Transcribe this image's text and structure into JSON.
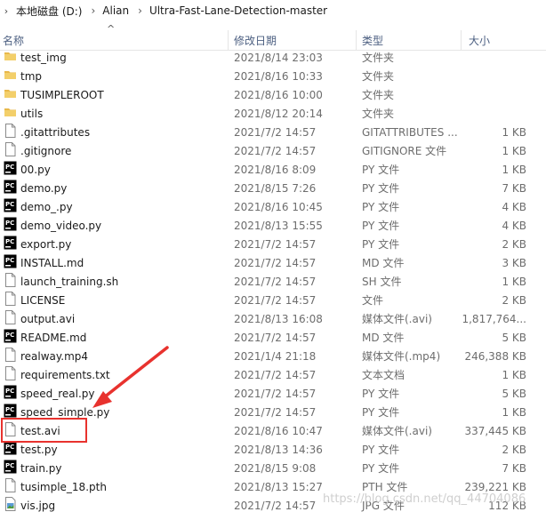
{
  "breadcrumb": {
    "segments": [
      "本地磁盘 (D:)",
      "Alian",
      "Ultra-Fast-Lane-Detection-master"
    ]
  },
  "columns": {
    "name": "名称",
    "date": "修改日期",
    "type": "类型",
    "size": "大小"
  },
  "files": [
    {
      "name": "test_img",
      "date": "2021/8/14 23:03",
      "type": "文件夹",
      "size": "",
      "icon": "folder-icon"
    },
    {
      "name": "tmp",
      "date": "2021/8/16 10:33",
      "type": "文件夹",
      "size": "",
      "icon": "folder-icon"
    },
    {
      "name": "TUSIMPLEROOT",
      "date": "2021/8/16 10:00",
      "type": "文件夹",
      "size": "",
      "icon": "folder-icon"
    },
    {
      "name": "utils",
      "date": "2021/8/12 20:14",
      "type": "文件夹",
      "size": "",
      "icon": "folder-icon"
    },
    {
      "name": ".gitattributes",
      "date": "2021/7/2 14:57",
      "type": "GITATTRIBUTES ...",
      "size": "1 KB",
      "icon": "file-icon"
    },
    {
      "name": ".gitignore",
      "date": "2021/7/2 14:57",
      "type": "GITIGNORE 文件",
      "size": "1 KB",
      "icon": "file-icon"
    },
    {
      "name": "00.py",
      "date": "2021/8/16 8:09",
      "type": "PY 文件",
      "size": "1 KB",
      "icon": "pycharm-icon"
    },
    {
      "name": "demo.py",
      "date": "2021/8/15 7:26",
      "type": "PY 文件",
      "size": "7 KB",
      "icon": "pycharm-icon"
    },
    {
      "name": "demo_.py",
      "date": "2021/8/16 10:45",
      "type": "PY 文件",
      "size": "4 KB",
      "icon": "pycharm-icon"
    },
    {
      "name": "demo_video.py",
      "date": "2021/8/13 15:55",
      "type": "PY 文件",
      "size": "4 KB",
      "icon": "pycharm-icon"
    },
    {
      "name": "export.py",
      "date": "2021/7/2 14:57",
      "type": "PY 文件",
      "size": "2 KB",
      "icon": "pycharm-icon"
    },
    {
      "name": "INSTALL.md",
      "date": "2021/7/2 14:57",
      "type": "MD 文件",
      "size": "3 KB",
      "icon": "pycharm-icon"
    },
    {
      "name": "launch_training.sh",
      "date": "2021/7/2 14:57",
      "type": "SH 文件",
      "size": "1 KB",
      "icon": "file-icon"
    },
    {
      "name": "LICENSE",
      "date": "2021/7/2 14:57",
      "type": "文件",
      "size": "2 KB",
      "icon": "file-icon"
    },
    {
      "name": "output.avi",
      "date": "2021/8/13 16:08",
      "type": "媒体文件(.avi)",
      "size": "1,817,764...",
      "icon": "file-icon"
    },
    {
      "name": "README.md",
      "date": "2021/7/2 14:57",
      "type": "MD 文件",
      "size": "5 KB",
      "icon": "pycharm-icon"
    },
    {
      "name": "realway.mp4",
      "date": "2021/1/4 21:18",
      "type": "媒体文件(.mp4)",
      "size": "246,388 KB",
      "icon": "file-icon"
    },
    {
      "name": "requirements.txt",
      "date": "2021/7/2 14:57",
      "type": "文本文档",
      "size": "1 KB",
      "icon": "file-icon"
    },
    {
      "name": "speed_real.py",
      "date": "2021/7/2 14:57",
      "type": "PY 文件",
      "size": "5 KB",
      "icon": "pycharm-icon"
    },
    {
      "name": "speed_simple.py",
      "date": "2021/7/2 14:57",
      "type": "PY 文件",
      "size": "1 KB",
      "icon": "pycharm-icon"
    },
    {
      "name": "test.avi",
      "date": "2021/8/16 10:47",
      "type": "媒体文件(.avi)",
      "size": "337,445 KB",
      "icon": "file-icon"
    },
    {
      "name": "test.py",
      "date": "2021/8/13 14:36",
      "type": "PY 文件",
      "size": "2 KB",
      "icon": "pycharm-icon"
    },
    {
      "name": "train.py",
      "date": "2021/8/15 9:08",
      "type": "PY 文件",
      "size": "7 KB",
      "icon": "pycharm-icon"
    },
    {
      "name": "tusimple_18.pth",
      "date": "2021/8/13 15:27",
      "type": "PTH 文件",
      "size": "239,221 KB",
      "icon": "file-icon"
    },
    {
      "name": "vis.jpg",
      "date": "2021/7/2 14:57",
      "type": "JPG 文件",
      "size": "112 KB",
      "icon": "image-icon"
    }
  ],
  "watermark": "https://blog.csdn.net/qq_44704086",
  "colors": {
    "highlight": "#e8322e",
    "folder": "#e8b84a",
    "header_text": "#4d6082"
  }
}
